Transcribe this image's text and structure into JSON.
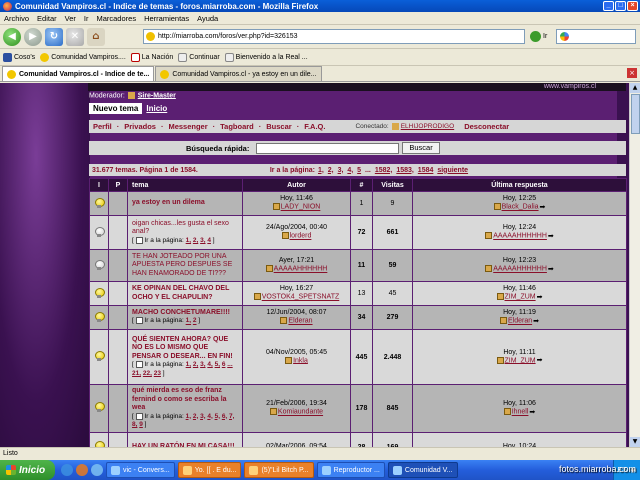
{
  "window": {
    "title": "Comunidad Vampiros.cl - Indice de temas - foros.miarroba.com - Mozilla Firefox"
  },
  "menu": [
    "Archivo",
    "Editar",
    "Ver",
    "Ir",
    "Marcadores",
    "Herramientas",
    "Ayuda"
  ],
  "nav": {
    "url": "http://miarroba.com/foros/ver.php?id=326153",
    "go_label": "Ir"
  },
  "bookmarks": [
    {
      "label": "Coso's",
      "icon": "page-icon"
    },
    {
      "label": "Comunidad Vampiros....",
      "icon": "vampiros-icon"
    },
    {
      "label": "La Nación",
      "icon": "nacion-icon"
    },
    {
      "label": "Continuar",
      "icon": "page-icon"
    },
    {
      "label": "Bienvenido a la Real ...",
      "icon": "page-icon"
    }
  ],
  "tabs": [
    {
      "label": "Comunidad Vampiros.cl - Indice de te...",
      "active": true
    },
    {
      "label": "Comunidad Vampiros.cl - ya estoy en un dile...",
      "active": false
    }
  ],
  "page": {
    "banner": "www.vampiros.cl",
    "moderator_label": "Moderador:",
    "moderator_name": "Sire-Master",
    "new_topic": "Nuevo tema",
    "home": "Inicio",
    "nav_links": [
      "Perfil",
      "Privados",
      "Messenger",
      "Tagboard",
      "Buscar",
      "F.A.Q."
    ],
    "connected_label": "Conectado:",
    "connected_user": "ELHIJOPRODIGO",
    "logout": "Desconectar",
    "quick_search_label": "Búsqueda rápida:",
    "search_button": "Buscar",
    "summary": "31.677 temas. Página 1 de 1584.",
    "goto_label": "Ir a la página:",
    "pages": [
      "1,",
      "2,",
      "3,",
      "4,",
      "5",
      "...",
      "1582,",
      "1583,",
      "1584",
      "siguiente"
    ]
  },
  "table": {
    "headers": [
      "I",
      "P",
      "tema",
      "Autor",
      "#",
      "Visitas",
      "Última respuesta"
    ],
    "rows": [
      {
        "icon": "on",
        "title": "ya estoy en un dilema",
        "bold": true,
        "pages": [],
        "autor_date": "Hoy, 11:46",
        "autor": "LADY_NION",
        "replies": "1",
        "visits": "9",
        "bold_nums": false,
        "last_date": "Hoy, 12:25",
        "last_user": "Black_Dalia"
      },
      {
        "icon": "off",
        "title": "oigan chicas...les gusta el sexo anal?",
        "bold": false,
        "pages": [
          "1,",
          "2,",
          "3,",
          "4"
        ],
        "autor_date": "24/Ago/2004, 00:40",
        "autor": "lorderd",
        "replies": "72",
        "visits": "661",
        "bold_nums": true,
        "last_date": "Hoy, 12:24",
        "last_user": "AAAAAHHHHHH"
      },
      {
        "icon": "off",
        "title": "TE HAN JOTEADO POR UNA APUESTA PERO DESPUES SE HAN ENAMORADO DE TI???",
        "bold": false,
        "pages": [],
        "autor_date": "Ayer, 17:21",
        "autor": "AAAAAHHHHHH",
        "replies": "11",
        "visits": "59",
        "bold_nums": true,
        "last_date": "Hoy, 12:23",
        "last_user": "AAAAAHHHHHH"
      },
      {
        "icon": "on",
        "title": "KE OPINAN DEL CHAVO DEL OCHO Y EL CHAPULIN?",
        "bold": true,
        "pages": [],
        "autor_date": "Hoy, 16:27",
        "autor": "VOSTOK4_SPETSNATZ",
        "replies": "13",
        "visits": "45",
        "bold_nums": false,
        "last_date": "Hoy, 11:46",
        "last_user": "ZIM_ZUM"
      },
      {
        "icon": "on",
        "title": "MACHO CONCHETUMARE!!!!",
        "bold": true,
        "pages": [
          "1,",
          "2"
        ],
        "autor_date": "12/Jun/2004, 08:07",
        "autor": "Elderan",
        "replies": "34",
        "visits": "279",
        "bold_nums": true,
        "last_date": "Hoy, 11:19",
        "last_user": "Elderan"
      },
      {
        "icon": "on",
        "title": "QUÉ SIENTEN AHORA? QUE NO ES LO MISMO QUE PENSAR O DESEAR... EN FIN!",
        "bold": true,
        "pages": [
          "1,",
          "2,",
          "3,",
          "4,",
          "5,",
          "6",
          "...",
          "21,",
          "22,",
          "23"
        ],
        "autor_date": "04/Nov/2005, 05:45",
        "autor": "Inkla",
        "replies": "445",
        "visits": "2.448",
        "bold_nums": true,
        "last_date": "Hoy, 11:11",
        "last_user": "ZIM_ZUM"
      },
      {
        "icon": "on",
        "title": "qué mierda es eso de franz fernind o como se escriba la wea",
        "bold": true,
        "pages": [
          "1,",
          "2,",
          "3,",
          "4,",
          "5,",
          "6,",
          "7,",
          "8,",
          "9"
        ],
        "autor_date": "21/Feb/2006, 19:34",
        "autor": "Komiaundante",
        "replies": "178",
        "visits": "845",
        "bold_nums": true,
        "last_date": "Hoy, 11:06",
        "last_user": "Ihnell"
      },
      {
        "icon": "on",
        "title": "HAY UN RATÓN EN MI CASA!!!",
        "bold": true,
        "pages": [],
        "autor_date": "02/Mar/2006, 09:54",
        "autor": "",
        "replies": "28",
        "visits": "169",
        "bold_nums": true,
        "last_date": "Hoy, 10:24",
        "last_user": ""
      }
    ],
    "page_label": "Ir a la página:"
  },
  "status": "Listo",
  "taskbar": {
    "start": "Inicio",
    "buttons": [
      {
        "label": "vic - Convers...",
        "style": "normal"
      },
      {
        "label": "Yo. [[ . E du...",
        "style": "orange"
      },
      {
        "label": "(5)\"Lil Bitch P...",
        "style": "orange"
      },
      {
        "label": "Reproductor ...",
        "style": "normal"
      },
      {
        "label": "Comunidad V...",
        "style": "active"
      }
    ],
    "tray_lang": "ES"
  },
  "watermark": "fotos.miarroba.com"
}
